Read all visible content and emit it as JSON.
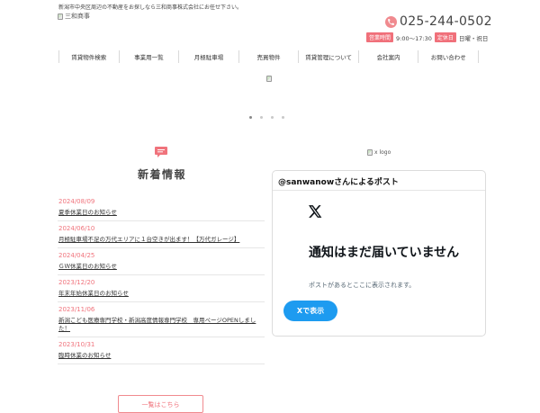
{
  "header": {
    "tagline": "新潟市中央区周辺の不動産をお探しなら三和商事株式会社にお任せ下さい。",
    "logo_alt": "三和商事",
    "phone": "025-244-0502",
    "hours_label": "営業時間",
    "hours_value": "9:00〜17:30",
    "holiday_label": "定休日",
    "holiday_value": "日曜・祝日"
  },
  "nav": {
    "items": [
      {
        "label": "賃貸物件検索"
      },
      {
        "label": "事業用一覧"
      },
      {
        "label": "月極駐車場"
      },
      {
        "label": "売買物件"
      },
      {
        "label": "賃貸管理について"
      },
      {
        "label": "会社案内"
      },
      {
        "label": "お問い合わせ"
      }
    ]
  },
  "slider": {
    "dot_count": 4,
    "active_index": 0
  },
  "news": {
    "title": "新着情報",
    "items": [
      {
        "date": "2024/08/09",
        "text": "夏季休業日のお知らせ"
      },
      {
        "date": "2024/06/10",
        "text": "月極駐車場不足の万代エリアに１台空きが出ます！【万代ガレージ】"
      },
      {
        "date": "2024/04/25",
        "text": "ＧＷ休業日のお知らせ"
      },
      {
        "date": "2023/12/20",
        "text": "年末年始休業日のお知らせ"
      },
      {
        "date": "2023/11/06",
        "text": "新潟こども医療専門学校・新潟高度情報専門学校　専用ページOPENしました！"
      },
      {
        "date": "2023/10/31",
        "text": "臨時休業のお知らせ"
      }
    ],
    "more_label": "一覧はこちら"
  },
  "x_widget": {
    "logo_alt": "x logo",
    "header": "@sanwanowさんによるポスト",
    "headline": "通知はまだ届いていません",
    "subtext": "ポストがあるとここに表示されます。",
    "button": "Xで表示"
  },
  "colors": {
    "accent": "#f0737c",
    "x_blue": "#1d9bf0"
  }
}
